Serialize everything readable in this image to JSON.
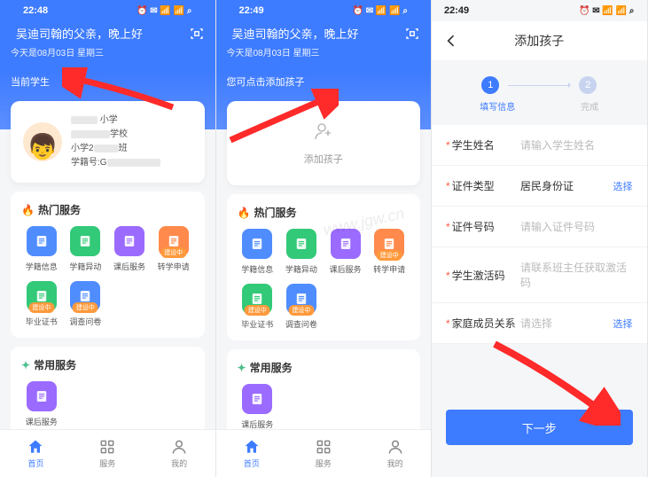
{
  "status": {
    "time1": "22:48",
    "time2": "22:49",
    "time3": "22:49",
    "icons": "⏰ ✉ 📶 📶 ⌕"
  },
  "header": {
    "greeting_prefix": "吴迪司翰的父亲，晚上好",
    "date": "今天是08月03日 星期三",
    "section_current": "当前学生",
    "section_add_hint": "您可点击添加孩子"
  },
  "student": {
    "line1_suffix": "小学",
    "line2_suffix": "学校",
    "line3_prefix": "小学2",
    "line3_suffix": "班",
    "line4_prefix": "学籍号:G"
  },
  "add_child": {
    "label": "添加孩子"
  },
  "panels": {
    "hot_title": "热门服务",
    "common_title": "常用服务"
  },
  "services": {
    "hot": [
      {
        "label": "学籍信息",
        "color": "#4f8dff",
        "badge": ""
      },
      {
        "label": "学籍异动",
        "color": "#32c978",
        "badge": ""
      },
      {
        "label": "课后服务",
        "color": "#9b6bff",
        "badge": ""
      },
      {
        "label": "转学申请",
        "color": "#ff8a4c",
        "badge": "建设中"
      },
      {
        "label": "毕业证书",
        "color": "#32c978",
        "badge": "建设中"
      },
      {
        "label": "调查问卷",
        "color": "#4f8dff",
        "badge": "建设中"
      }
    ],
    "common": [
      {
        "label": "课后服务",
        "color": "#9b6bff"
      }
    ]
  },
  "nav": {
    "home": "首页",
    "service": "服务",
    "mine": "我的"
  },
  "screen3": {
    "title": "添加孩子",
    "step1": "填写信息",
    "step2": "完成",
    "rows": [
      {
        "req": true,
        "label": "学生姓名",
        "placeholder": "请输入学生姓名",
        "action": ""
      },
      {
        "req": true,
        "label": "证件类型",
        "placeholder": "居民身份证",
        "filled": true,
        "action": "选择"
      },
      {
        "req": true,
        "label": "证件号码",
        "placeholder": "请输入证件号码",
        "action": ""
      },
      {
        "req": true,
        "label": "学生激活码",
        "placeholder": "请联系班主任获取激活码",
        "action": ""
      },
      {
        "req": true,
        "label": "家庭成员关系",
        "placeholder": "请选择",
        "action": "选择"
      }
    ],
    "next": "下一步"
  },
  "watermark": "www.jgw.cn"
}
